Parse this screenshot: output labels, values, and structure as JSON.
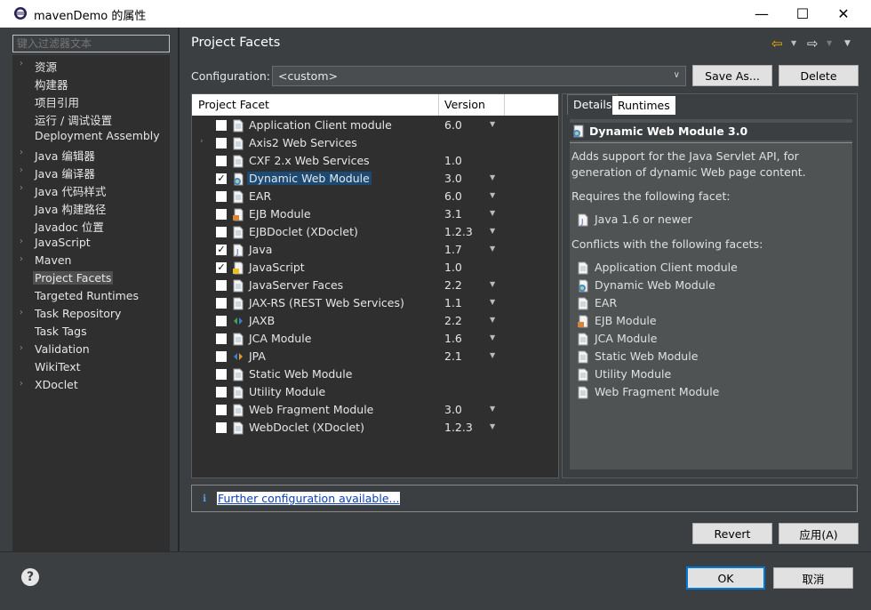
{
  "window": {
    "title": "mavenDemo 的属性",
    "min_icon": "minimize-icon",
    "max_icon": "maximize-icon",
    "close_icon": "close-icon"
  },
  "filter": {
    "placeholder": "键入过滤器文本"
  },
  "nav": {
    "items": [
      {
        "label": "资源",
        "expandable": true
      },
      {
        "label": "构建器",
        "expandable": false
      },
      {
        "label": "项目引用",
        "expandable": false
      },
      {
        "label": "运行 / 调试设置",
        "expandable": false
      },
      {
        "label": "Deployment Assembly",
        "expandable": false
      },
      {
        "label": "Java 编辑器",
        "expandable": true
      },
      {
        "label": "Java 编译器",
        "expandable": true
      },
      {
        "label": "Java 代码样式",
        "expandable": true
      },
      {
        "label": "Java 构建路径",
        "expandable": false
      },
      {
        "label": "Javadoc 位置",
        "expandable": false
      },
      {
        "label": "JavaScript",
        "expandable": true
      },
      {
        "label": "Maven",
        "expandable": true
      },
      {
        "label": "Project Facets",
        "expandable": false,
        "selected": true
      },
      {
        "label": "Targeted Runtimes",
        "expandable": false
      },
      {
        "label": "Task Repository",
        "expandable": true
      },
      {
        "label": "Task Tags",
        "expandable": false
      },
      {
        "label": "Validation",
        "expandable": true
      },
      {
        "label": "WikiText",
        "expandable": false
      },
      {
        "label": "XDoclet",
        "expandable": true
      }
    ]
  },
  "page": {
    "title": "Project Facets",
    "back_icon": "back-arrow-icon",
    "forward_icon": "forward-arrow-icon",
    "menu_icon": "view-menu-icon"
  },
  "configuration": {
    "label": "Configuration:",
    "value": "<custom>",
    "save_as": "Save As...",
    "delete": "Delete"
  },
  "facets": {
    "col_facet": "Project Facet",
    "col_version": "Version",
    "rows": [
      {
        "name": "Application Client module",
        "version": "6.0",
        "checked": false,
        "dropdown": true,
        "expander": false
      },
      {
        "name": "Axis2 Web Services",
        "version": "",
        "checked": false,
        "dropdown": false,
        "expander": true
      },
      {
        "name": "CXF 2.x Web Services",
        "version": "1.0",
        "checked": false,
        "dropdown": false,
        "expander": false
      },
      {
        "name": "Dynamic Web Module",
        "version": "3.0",
        "checked": true,
        "dropdown": true,
        "expander": false,
        "selected": true
      },
      {
        "name": "EAR",
        "version": "6.0",
        "checked": false,
        "dropdown": true,
        "expander": false
      },
      {
        "name": "EJB Module",
        "version": "3.1",
        "checked": false,
        "dropdown": true,
        "expander": false
      },
      {
        "name": "EJBDoclet (XDoclet)",
        "version": "1.2.3",
        "checked": false,
        "dropdown": true,
        "expander": false
      },
      {
        "name": "Java",
        "version": "1.7",
        "checked": true,
        "dropdown": true,
        "expander": false
      },
      {
        "name": "JavaScript",
        "version": "1.0",
        "checked": true,
        "dropdown": false,
        "expander": false
      },
      {
        "name": "JavaServer Faces",
        "version": "2.2",
        "checked": false,
        "dropdown": true,
        "expander": false
      },
      {
        "name": "JAX-RS (REST Web Services)",
        "version": "1.1",
        "checked": false,
        "dropdown": true,
        "expander": false
      },
      {
        "name": "JAXB",
        "version": "2.2",
        "checked": false,
        "dropdown": true,
        "expander": false
      },
      {
        "name": "JCA Module",
        "version": "1.6",
        "checked": false,
        "dropdown": true,
        "expander": false
      },
      {
        "name": "JPA",
        "version": "2.1",
        "checked": false,
        "dropdown": true,
        "expander": false
      },
      {
        "name": "Static Web Module",
        "version": "",
        "checked": false,
        "dropdown": false,
        "expander": false
      },
      {
        "name": "Utility Module",
        "version": "",
        "checked": false,
        "dropdown": false,
        "expander": false
      },
      {
        "name": "Web Fragment Module",
        "version": "3.0",
        "checked": false,
        "dropdown": true,
        "expander": false
      },
      {
        "name": "WebDoclet (XDoclet)",
        "version": "1.2.3",
        "checked": false,
        "dropdown": true,
        "expander": false
      }
    ]
  },
  "details": {
    "tab_details": "Details",
    "tab_runtimes": "Runtimes",
    "title": "Dynamic Web Module 3.0",
    "desc_line1": "Adds support for the Java Servlet API, for",
    "desc_line2": "generation of dynamic Web page content.",
    "requires_label": "Requires the following facet:",
    "requires": [
      "Java 1.6 or newer"
    ],
    "conflicts_label": "Conflicts with the following facets:",
    "conflicts": [
      "Application Client module",
      "Dynamic Web Module",
      "EAR",
      "EJB Module",
      "JCA Module",
      "Static Web Module",
      "Utility Module",
      "Web Fragment Module"
    ]
  },
  "further": {
    "link": "Further configuration available..."
  },
  "buttons": {
    "revert": "Revert",
    "apply": "应用(A)",
    "ok": "OK",
    "cancel": "取消"
  }
}
